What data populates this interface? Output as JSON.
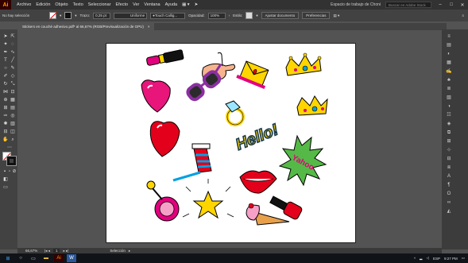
{
  "app": {
    "logo": "Ai"
  },
  "menubar": {
    "items": [
      "Archivo",
      "Edición",
      "Objeto",
      "Texto",
      "Seleccionar",
      "Efecto",
      "Ver",
      "Ventana",
      "Ayuda"
    ],
    "workspace": "Espacio de trabajo de Choni",
    "help_search_placeholder": "Buscar en Adobe Stock"
  },
  "controlbar": {
    "selection_label": "No hay selección",
    "stroke_label": "Trazo:",
    "stroke_value": "0,25 pt",
    "profile_label": "Uniforme",
    "brush_label": "Touch Callig...",
    "opacity_label": "Opacidad:",
    "opacity_value": "100%",
    "style_label": "Estilo:",
    "adjust_doc_button": "Ajustar documento",
    "preferences_button": "Preferencias"
  },
  "document": {
    "tab_title": "Stickers en couché adhesivo.pdf* al 66,67% (RGB/Previsualización de GPU)",
    "close_glyph": "×",
    "sticker_hello_text": "Hello!",
    "sticker_yahoo_text": "Yahoo"
  },
  "status": {
    "zoom": "66,67%",
    "page": "1",
    "tool": "Selección"
  },
  "taskbar": {
    "lang": "ESP",
    "time": "9:27 PM"
  },
  "colors": {
    "menubar_bg": "#323232",
    "panel_bg": "#424242",
    "canvas_bg": "#535353",
    "artboard_bg": "#ffffff",
    "brand_orange": "#ff9a00"
  }
}
